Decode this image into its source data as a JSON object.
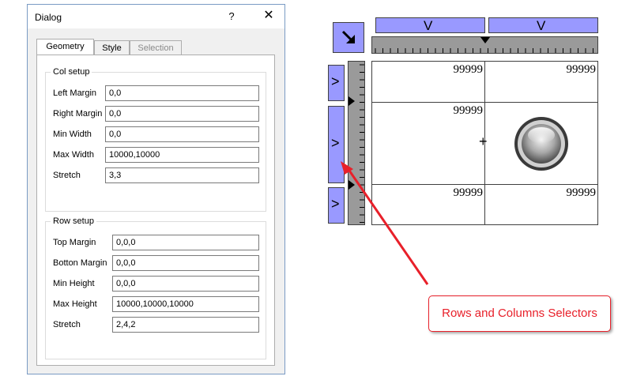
{
  "dialog": {
    "title": "Dialog",
    "help": "?",
    "close": "✕",
    "tabs": [
      {
        "label": "Geometry",
        "state": "active"
      },
      {
        "label": "Style",
        "state": "normal"
      },
      {
        "label": "Selection",
        "state": "disabled"
      }
    ],
    "col_setup": {
      "title": "Col setup",
      "fields": [
        {
          "label": "Left Margin",
          "value": "0,0"
        },
        {
          "label": "Right Margin",
          "value": "0,0"
        },
        {
          "label": "Min Width",
          "value": "0,0"
        },
        {
          "label": "Max Width",
          "value": "10000,10000"
        },
        {
          "label": "Stretch",
          "value": "3,3"
        }
      ]
    },
    "row_setup": {
      "title": "Row setup",
      "fields": [
        {
          "label": "Top Margin",
          "value": "0,0,0"
        },
        {
          "label": "Botton Margin",
          "value": "0,0,0"
        },
        {
          "label": "Min Height",
          "value": "0,0,0"
        },
        {
          "label": "Max Height",
          "value": "10000,10000,10000"
        },
        {
          "label": "Stretch",
          "value": "2,4,2"
        }
      ]
    }
  },
  "grid": {
    "column_selector_glyph": "V",
    "row_selector_glyph": ">",
    "corner_icon": "arrow-down-right-icon",
    "cells": {
      "r0c0": "99999",
      "r0c1": "99999",
      "r1c0": "99999",
      "r2c0": "99999",
      "r2c1": "99999"
    },
    "center_mark": "+"
  },
  "callout": {
    "text": "Rows and Columns Selectors",
    "color": "#e8202a"
  },
  "colors": {
    "selector": "#9999ff",
    "ruler": "#9a9a9a",
    "dialog_border": "#7a9bc4"
  }
}
